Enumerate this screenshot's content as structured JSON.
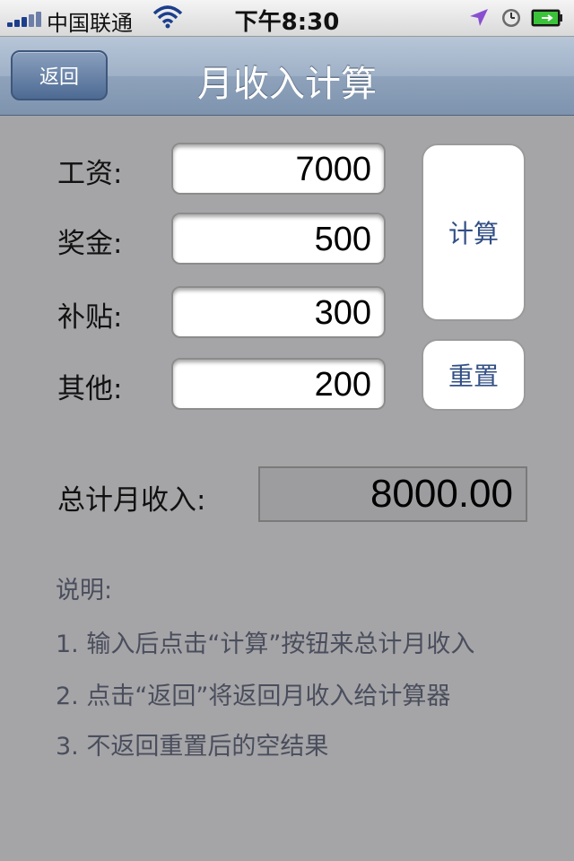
{
  "status_bar": {
    "carrier": "中国联通",
    "time": "下午8:30"
  },
  "nav": {
    "back_label": "返回",
    "title": "月收入计算"
  },
  "form": {
    "fields": [
      {
        "label": "工资:",
        "value": "7000"
      },
      {
        "label": "奖金:",
        "value": "500"
      },
      {
        "label": "补贴:",
        "value": "300"
      },
      {
        "label": "其他:",
        "value": "200"
      }
    ],
    "calc_label": "计算",
    "reset_label": "重置"
  },
  "total": {
    "label": "总计月收入:",
    "value": "8000.00"
  },
  "notes": {
    "heading": "说明:",
    "lines": [
      "1. 输入后点击“计算”按钮来总计月收入",
      "2. 点击“返回”将返回月收入给计算器",
      "3. 不返回重置后的空结果"
    ]
  },
  "colors": {
    "background": "#a5a5a8",
    "nav_bar": "#9fb1c7",
    "button_text": "#324f85",
    "location_arrow": "#8a4fd0",
    "battery_green": "#3bc23b"
  },
  "icons": [
    "signal-icon",
    "wifi-icon",
    "location-icon",
    "alarm-clock-icon",
    "battery-icon"
  ]
}
